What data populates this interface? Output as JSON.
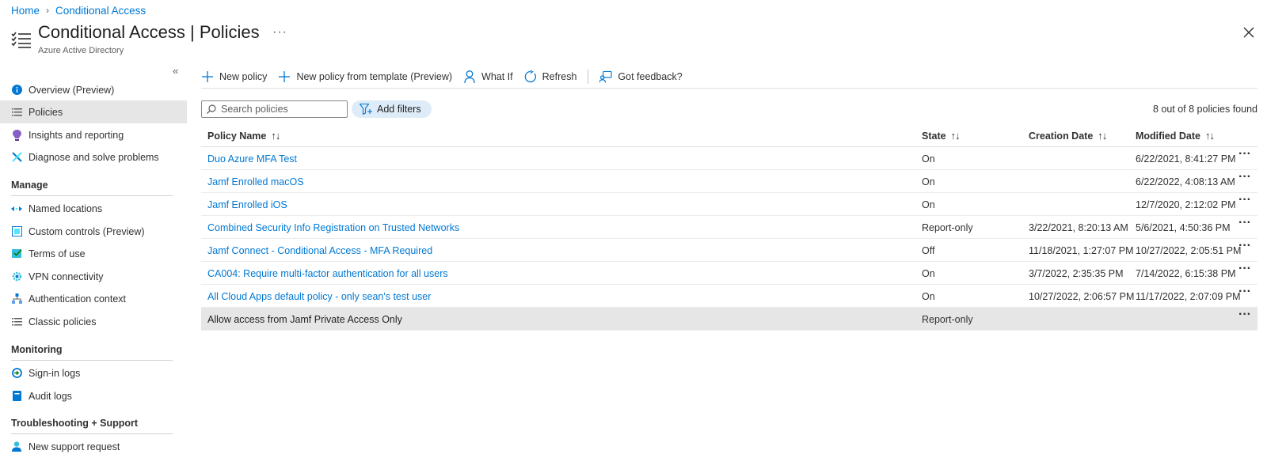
{
  "breadcrumb": {
    "home": "Home",
    "current": "Conditional Access"
  },
  "header": {
    "title": "Conditional Access | Policies",
    "subtitle": "Azure Active Directory",
    "more": "···"
  },
  "sidebar": {
    "collapse": "«",
    "items_top": [
      {
        "label": "Overview (Preview)",
        "icon": "info-icon"
      },
      {
        "label": "Policies",
        "icon": "list-icon",
        "active": true
      },
      {
        "label": "Insights and reporting",
        "icon": "bulb-icon"
      },
      {
        "label": "Diagnose and solve problems",
        "icon": "wrench-icon"
      }
    ],
    "manage_heading": "Manage",
    "manage_items": [
      {
        "label": "Named locations",
        "icon": "locations-icon"
      },
      {
        "label": "Custom controls (Preview)",
        "icon": "custom-controls-icon"
      },
      {
        "label": "Terms of use",
        "icon": "terms-icon"
      },
      {
        "label": "VPN connectivity",
        "icon": "gear-icon"
      },
      {
        "label": "Authentication context",
        "icon": "hierarchy-icon"
      },
      {
        "label": "Classic policies",
        "icon": "list-icon"
      }
    ],
    "monitoring_heading": "Monitoring",
    "monitoring_items": [
      {
        "label": "Sign-in logs",
        "icon": "signin-icon"
      },
      {
        "label": "Audit logs",
        "icon": "book-icon"
      }
    ],
    "support_heading": "Troubleshooting + Support",
    "support_items": [
      {
        "label": "New support request",
        "icon": "person-support-icon"
      }
    ]
  },
  "toolbar": {
    "new_policy": "New policy",
    "new_from_template": "New policy from template (Preview)",
    "what_if": "What If",
    "refresh": "Refresh",
    "feedback": "Got feedback?"
  },
  "filters": {
    "search_placeholder": "Search policies",
    "add_filters": "Add filters",
    "count": "8 out of 8 policies found"
  },
  "table": {
    "columns": {
      "name": "Policy Name",
      "state": "State",
      "created": "Creation Date",
      "modified": "Modified Date",
      "sort": "↑↓"
    },
    "rows": [
      {
        "name": "Duo Azure MFA Test",
        "state": "On",
        "created": "",
        "modified": "6/22/2021, 8:41:27 PM"
      },
      {
        "name": "Jamf Enrolled macOS",
        "state": "On",
        "created": "",
        "modified": "6/22/2022, 4:08:13 AM"
      },
      {
        "name": "Jamf Enrolled iOS",
        "state": "On",
        "created": "",
        "modified": "12/7/2020, 2:12:02 PM"
      },
      {
        "name": "Combined Security Info Registration on Trusted Networks",
        "state": "Report-only",
        "created": "3/22/2021, 8:20:13 AM",
        "modified": "5/6/2021, 4:50:36 PM"
      },
      {
        "name": "Jamf Connect - Conditional Access - MFA Required",
        "state": "Off",
        "created": "11/18/2021, 1:27:07 PM",
        "modified": "10/27/2022, 2:05:51 PM"
      },
      {
        "name": "CA004: Require multi-factor authentication for all users",
        "state": "On",
        "created": "3/7/2022, 2:35:35 PM",
        "modified": "7/14/2022, 6:15:38 PM"
      },
      {
        "name": "All Cloud Apps default policy - only sean's test user",
        "state": "On",
        "created": "10/27/2022, 2:06:57 PM",
        "modified": "11/17/2022, 2:07:09 PM"
      },
      {
        "name": "Allow access from Jamf Private Access Only",
        "state": "Report-only",
        "created": "",
        "modified": "",
        "selected": true
      }
    ],
    "row_more": "···"
  }
}
